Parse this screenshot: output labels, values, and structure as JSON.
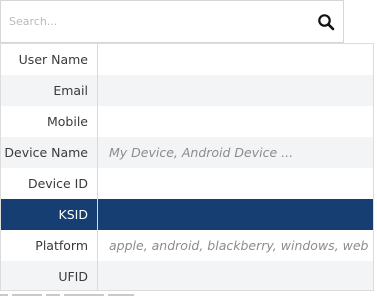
{
  "search": {
    "placeholder": "Search..."
  },
  "fields": [
    {
      "label": "User Name",
      "placeholder": ""
    },
    {
      "label": "Email",
      "placeholder": ""
    },
    {
      "label": "Mobile",
      "placeholder": ""
    },
    {
      "label": "Device Name",
      "placeholder": "My Device, Android Device ..."
    },
    {
      "label": "Device ID",
      "placeholder": ""
    },
    {
      "label": "KSID",
      "placeholder": ""
    },
    {
      "label": "Platform",
      "placeholder": "apple, android, blackberry, windows, web"
    },
    {
      "label": "UFID",
      "placeholder": ""
    }
  ],
  "colors": {
    "selected_row": "#173e72",
    "alt_row": "#f3f4f6"
  },
  "icons": {
    "search": "search-icon"
  }
}
